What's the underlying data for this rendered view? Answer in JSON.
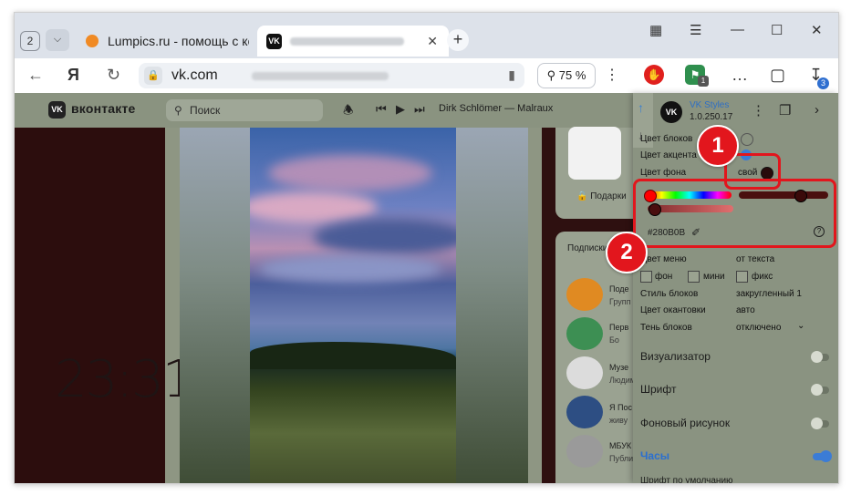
{
  "browser": {
    "tab_count": "2",
    "tabs": [
      {
        "title": "Lumpics.ru - помощь с ком"
      },
      {
        "title": ""
      }
    ],
    "domain": "vk.com",
    "zoom": "75 %",
    "extension_badge": "3",
    "shield_badge": "1"
  },
  "vk": {
    "brand": "вконтакте",
    "search_placeholder": "Поиск",
    "now_playing": "Dirk Schlömer — Malraux",
    "clock": "23:31",
    "gifts_label": "Подарки",
    "subscriptions_label": "Подписки",
    "groups": [
      {
        "name": "Поде",
        "sub": "Групп"
      },
      {
        "name": "Перв",
        "sub": "Бо"
      },
      {
        "name": "Музе",
        "sub": "Людим"
      },
      {
        "name": "Я Пос",
        "sub": "живу"
      },
      {
        "name": "МБУК",
        "sub": "Публи"
      }
    ]
  },
  "panel": {
    "title": "VK Styles",
    "version": "1.0.250.17",
    "rows": {
      "block_color": "Цвет блоков",
      "accent_color": "Цвет акцента",
      "bg_color": "Цвет фона",
      "bg_color_value": "свой",
      "hex": "#280B0B",
      "menu_color": "Цвет меню",
      "menu_color_value": "от текста",
      "opt_bg": "фон",
      "opt_mini": "мини",
      "opt_fix": "фикс",
      "block_style": "Стиль блоков",
      "block_style_value": "закругленный 1",
      "border_color": "Цвет окантовки",
      "border_color_value": "авто",
      "block_shadow": "Тень блоков",
      "block_shadow_value": "отключено"
    },
    "sections": [
      {
        "label": "Визуализатор",
        "on": false
      },
      {
        "label": "Шрифт",
        "on": false
      },
      {
        "label": "Фоновый рисунок",
        "on": false
      },
      {
        "label": "Часы",
        "on": true
      },
      {
        "label": "Шрифт по умолчанию",
        "on": false
      }
    ],
    "colors": {
      "accent": "#3b7cd6",
      "background": "#280B0B",
      "annotation": "#e2161d"
    }
  },
  "annotations": {
    "step1": "1",
    "step2": "2"
  }
}
